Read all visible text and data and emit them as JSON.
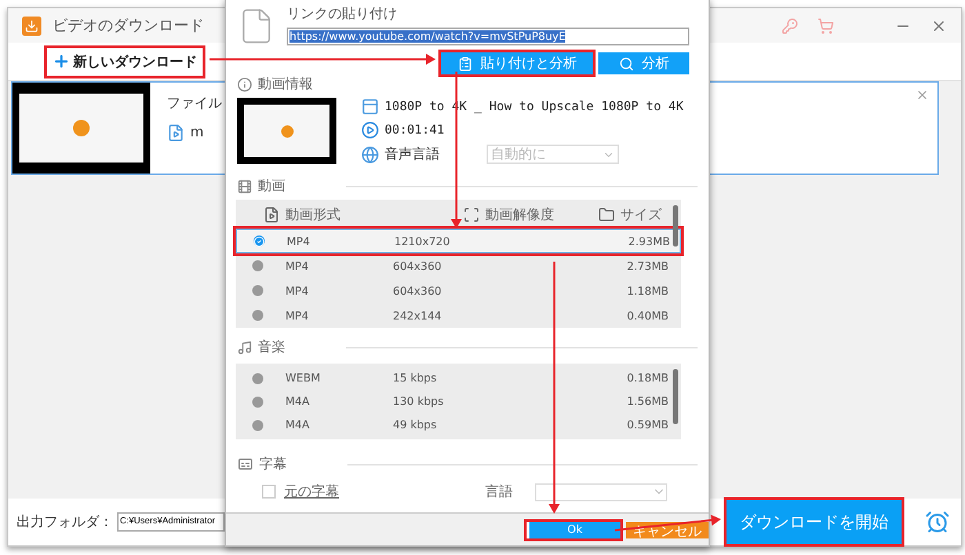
{
  "main_window": {
    "title": "ビデオのダウンロード",
    "new_download": {
      "label": "新しいダウンロード",
      "highlighted": true
    },
    "task": {
      "file_label": "ファイル",
      "file_name": "m"
    },
    "output": {
      "label": "出力フォルダ：",
      "path": "C:¥Users¥Administrator"
    },
    "start_button": {
      "label": "ダウンロードを開始",
      "highlighted": true
    }
  },
  "dialog": {
    "link_label": "リンクの貼り付け",
    "url": "https://www.youtube.com/watch?v=mvStPuP8uyE",
    "buttons": [
      {
        "kind": "paste",
        "label": "貼り付けと分析",
        "highlighted": true
      },
      {
        "kind": "search",
        "label": "分析",
        "highlighted": false
      }
    ],
    "info": {
      "heading": "動画情報",
      "title": "1080P to 4K _ How to Upscale 1080P to 4K",
      "duration": "00:01:41",
      "audio_label": "音声言語",
      "audio_select": "自動的に"
    },
    "video": {
      "heading": "動画",
      "columns": [
        "動画形式",
        "動画解像度",
        "サイズ"
      ],
      "rows": [
        {
          "format": "MP4",
          "resolution": "1210x720",
          "size": "2.93MB",
          "selected": true,
          "highlighted": true
        },
        {
          "format": "MP4",
          "resolution": "604x360",
          "size": "2.73MB",
          "selected": false,
          "highlighted": false
        },
        {
          "format": "MP4",
          "resolution": "604x360",
          "size": "1.18MB",
          "selected": false,
          "highlighted": false
        },
        {
          "format": "MP4",
          "resolution": "242x144",
          "size": "0.40MB",
          "selected": false,
          "highlighted": false
        }
      ]
    },
    "audio": {
      "heading": "音楽",
      "rows": [
        {
          "format": "WEBM",
          "bitrate": "15 kbps",
          "size": "0.18MB",
          "selected": false
        },
        {
          "format": "M4A",
          "bitrate": "130 kbps",
          "size": "1.56MB",
          "selected": false
        },
        {
          "format": "M4A",
          "bitrate": "49 kbps",
          "size": "0.59MB",
          "selected": false
        }
      ]
    },
    "subtitles": {
      "heading": "字幕",
      "checkbox": {
        "label": "元の字幕",
        "checked": false
      },
      "language_label": "言語"
    },
    "ok": {
      "label": "Ok",
      "highlighted": true
    },
    "cancel": {
      "label": "キャンセル"
    }
  }
}
